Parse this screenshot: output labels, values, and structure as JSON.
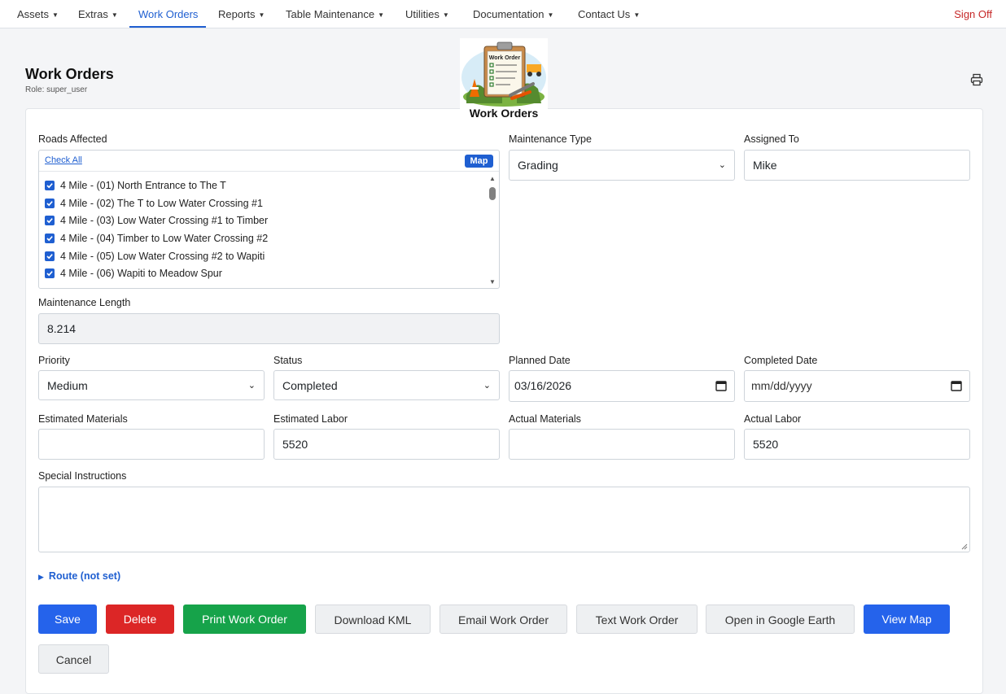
{
  "nav": {
    "items": [
      {
        "label": "Assets"
      },
      {
        "label": "Extras"
      },
      {
        "label": "Work Orders"
      },
      {
        "label": "Reports"
      },
      {
        "label": "Table Maintenance"
      },
      {
        "label": "Utilities"
      },
      {
        "label": "Documentation"
      },
      {
        "label": "Contact Us"
      }
    ],
    "active": "Work Orders",
    "sign_off": "Sign Off"
  },
  "header": {
    "title": "Work Orders",
    "role": "Role: super_user",
    "logo_clipboard_text": "Work Order",
    "logo_caption": "Work Orders"
  },
  "form": {
    "roads_affected": {
      "label": "Roads Affected",
      "check_all": "Check All",
      "map_button": "Map",
      "roads": [
        {
          "label": "4 Mile - (01) North Entrance to The T",
          "checked": true
        },
        {
          "label": "4 Mile - (02) The T to Low Water Crossing #1",
          "checked": true
        },
        {
          "label": "4 Mile - (03) Low Water Crossing #1 to Timber",
          "checked": true
        },
        {
          "label": "4 Mile - (04) Timber to Low Water Crossing #2",
          "checked": true
        },
        {
          "label": "4 Mile - (05) Low Water Crossing #2 to Wapiti",
          "checked": true
        },
        {
          "label": "4 Mile - (06) Wapiti to Meadow Spur",
          "checked": true
        }
      ]
    },
    "maintenance_type": {
      "label": "Maintenance Type",
      "value": "Grading"
    },
    "assigned_to": {
      "label": "Assigned To",
      "value": "Mike"
    },
    "maintenance_length": {
      "label": "Maintenance Length",
      "value": "8.214"
    },
    "priority": {
      "label": "Priority",
      "value": "Medium"
    },
    "status": {
      "label": "Status",
      "value": "Completed"
    },
    "planned_date": {
      "label": "Planned Date",
      "value": "03/16/2026"
    },
    "completed_date": {
      "label": "Completed Date",
      "value": "mm/dd/yyyy"
    },
    "estimated_materials": {
      "label": "Estimated Materials",
      "value": ""
    },
    "estimated_labor": {
      "label": "Estimated Labor",
      "value": "5520"
    },
    "actual_materials": {
      "label": "Actual Materials",
      "value": ""
    },
    "actual_labor": {
      "label": "Actual Labor",
      "value": "5520"
    },
    "special_instructions": {
      "label": "Special Instructions",
      "value": ""
    },
    "route": "Route (not set)"
  },
  "buttons": {
    "save": "Save",
    "delete": "Delete",
    "print": "Print Work Order",
    "download_kml": "Download KML",
    "email": "Email Work Order",
    "text": "Text Work Order",
    "google_earth": "Open in Google Earth",
    "view_map": "View Map",
    "cancel": "Cancel"
  },
  "colors": {
    "primary": "#2563eb",
    "danger": "#dc2626",
    "success": "#16a34a",
    "sign_off": "#c62828"
  }
}
